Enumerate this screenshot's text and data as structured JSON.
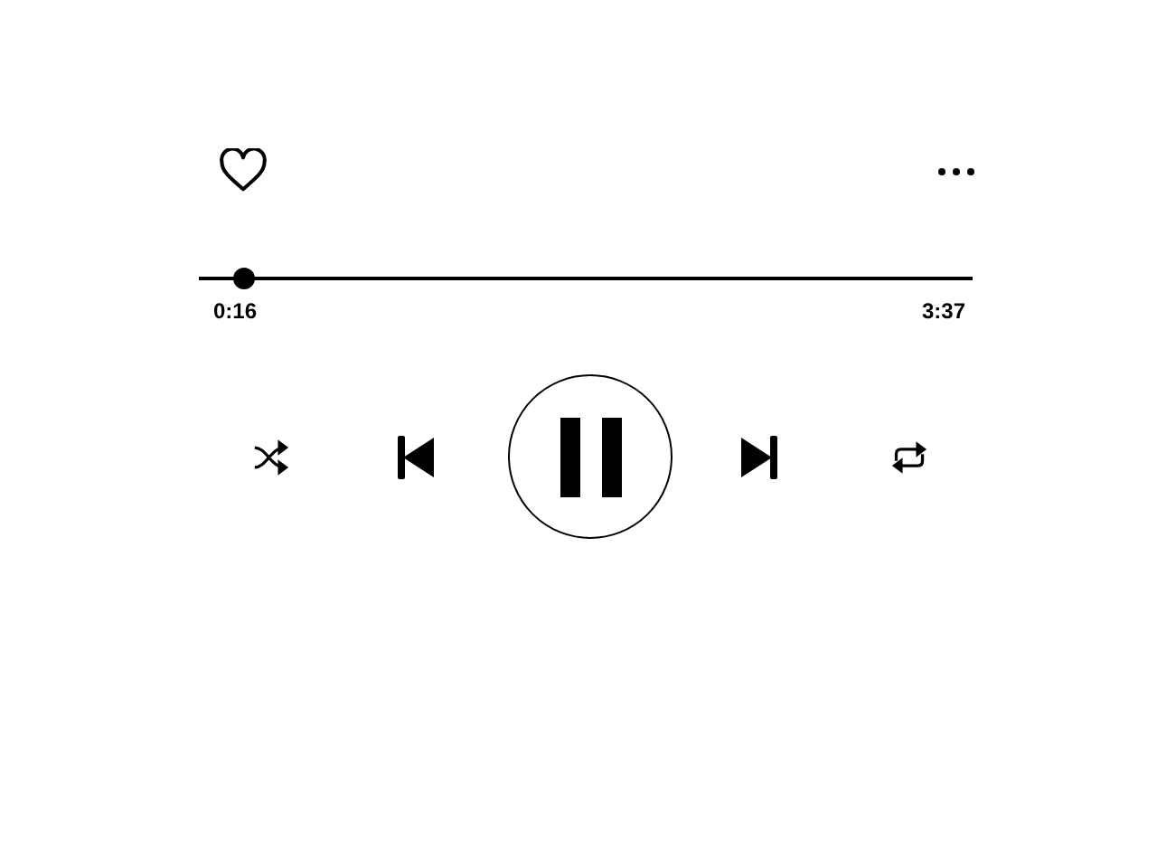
{
  "player": {
    "liked": false,
    "playing": true,
    "progress": {
      "level": 0.058,
      "elapsed": "0:16",
      "duration": "3:37"
    }
  }
}
